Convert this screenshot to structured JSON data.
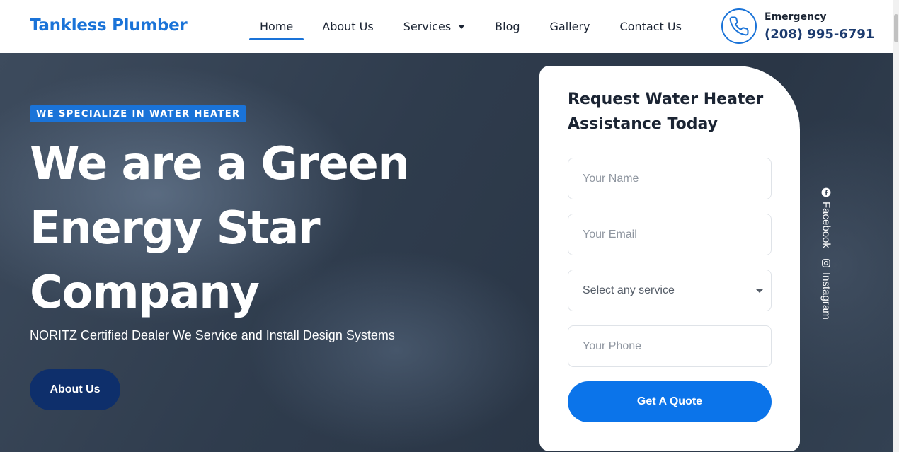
{
  "header": {
    "logo": "Tankless Plumber",
    "nav": {
      "home": "Home",
      "about": "About Us",
      "services": "Services",
      "blog": "Blog",
      "gallery": "Gallery",
      "contact": "Contact Us"
    },
    "emergency_label": "Emergency",
    "emergency_number": "(208) 995-6791"
  },
  "hero": {
    "badge": "WE SPECIALIZE IN WATER HEATER",
    "title": "We are a Green Energy Star Company",
    "subtitle": "NORITZ Certified Dealer We Service and Install Design Systems",
    "about_button": "About Us"
  },
  "form": {
    "title": "Request Water Heater Assistance Today",
    "name_placeholder": "Your Name",
    "email_placeholder": "Your Email",
    "service_select": "Select any service",
    "phone_placeholder": "Your Phone",
    "submit": "Get A Quote"
  },
  "social": {
    "facebook": "Facebook",
    "instagram": "Instagram"
  },
  "colors": {
    "accent": "#1a73d8",
    "button_primary": "#0b74ea",
    "button_dark": "#0e2f6b",
    "text_dark": "#1b2433"
  }
}
